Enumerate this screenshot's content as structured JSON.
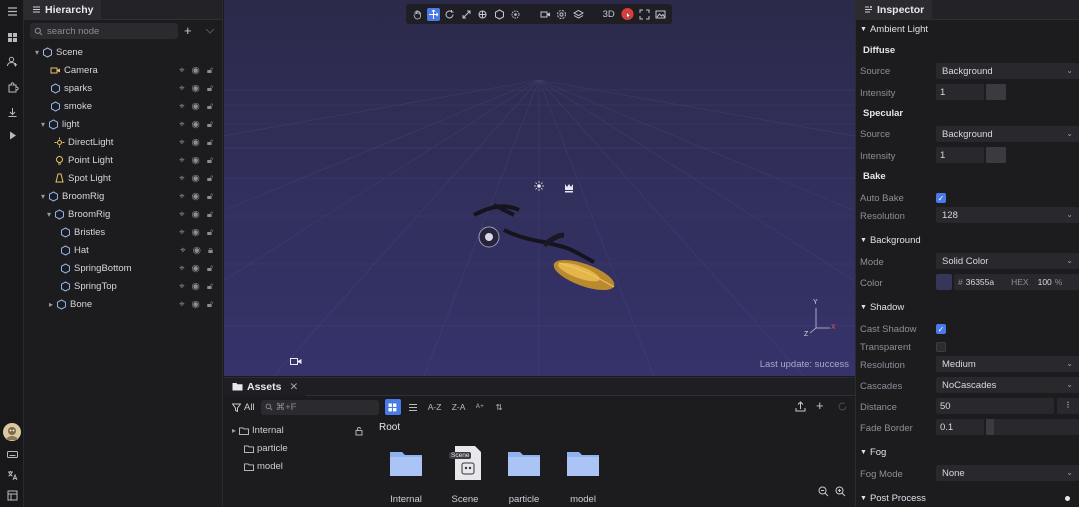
{
  "hierarchy": {
    "tab_title": "Hierarchy",
    "search_placeholder": "search node",
    "nodes": [
      {
        "label": "Scene"
      },
      {
        "label": "Camera"
      },
      {
        "label": "sparks"
      },
      {
        "label": "smoke"
      },
      {
        "label": "light"
      },
      {
        "label": "DirectLight"
      },
      {
        "label": "Point Light"
      },
      {
        "label": "Spot Light"
      },
      {
        "label": "BroomRig"
      },
      {
        "label": "BroomRig"
      },
      {
        "label": "Bristles"
      },
      {
        "label": "Hat"
      },
      {
        "label": "SpringBottom"
      },
      {
        "label": "SpringTop"
      },
      {
        "label": "Bone"
      }
    ]
  },
  "viewport": {
    "mode_label": "3D",
    "status": "Last update: success",
    "gizmo_axes": {
      "y": "Y",
      "x": "X",
      "z": "Z"
    }
  },
  "assets": {
    "tab_title": "Assets",
    "filter_label": "All",
    "search_placeholder": "⌘+F",
    "sort_az": "A-Z",
    "sort_za": "Z-A",
    "tree": [
      "Internal",
      "particle",
      "model"
    ],
    "breadcrumb": "Root",
    "items": [
      {
        "label": "Internal",
        "kind": "folder"
      },
      {
        "label": "Scene",
        "kind": "scene",
        "badge": "Scene"
      },
      {
        "label": "particle",
        "kind": "folder"
      },
      {
        "label": "model",
        "kind": "folder"
      }
    ]
  },
  "inspector": {
    "tab_title": "Inspector",
    "ambient_light": {
      "title": "Ambient Light",
      "diffuse": {
        "title": "Diffuse",
        "source_label": "Source",
        "source_value": "Background",
        "intensity_label": "Intensity",
        "intensity_value": "1"
      },
      "specular": {
        "title": "Specular",
        "source_label": "Source",
        "source_value": "Background",
        "intensity_label": "Intensity",
        "intensity_value": "1"
      },
      "bake": {
        "title": "Bake",
        "auto_bake_label": "Auto Bake",
        "auto_bake": true,
        "resolution_label": "Resolution",
        "resolution_value": "128"
      }
    },
    "background": {
      "title": "Background",
      "mode_label": "Mode",
      "mode_value": "Solid Color",
      "color_label": "Color",
      "color_hex": "#36355a",
      "hex_text": "36355a",
      "hex_label": "HEX",
      "alpha": "100",
      "alpha_unit": "%"
    },
    "shadow": {
      "title": "Shadow",
      "cast_label": "Cast Shadow",
      "cast": true,
      "transparent_label": "Transparent",
      "transparent": false,
      "resolution_label": "Resolution",
      "resolution_value": "Medium",
      "cascades_label": "Cascades",
      "cascades_value": "NoCascades",
      "distance_label": "Distance",
      "distance_value": "50",
      "fade_label": "Fade Border",
      "fade_value": "0.1"
    },
    "fog": {
      "title": "Fog",
      "mode_label": "Fog Mode",
      "mode_value": "None"
    },
    "post_process": {
      "title": "Post Process"
    }
  },
  "colors": {
    "accent": "#4a7ae8",
    "record": "#e03c3c",
    "viewport": "#34326a",
    "panel": "#1c1c1f"
  }
}
